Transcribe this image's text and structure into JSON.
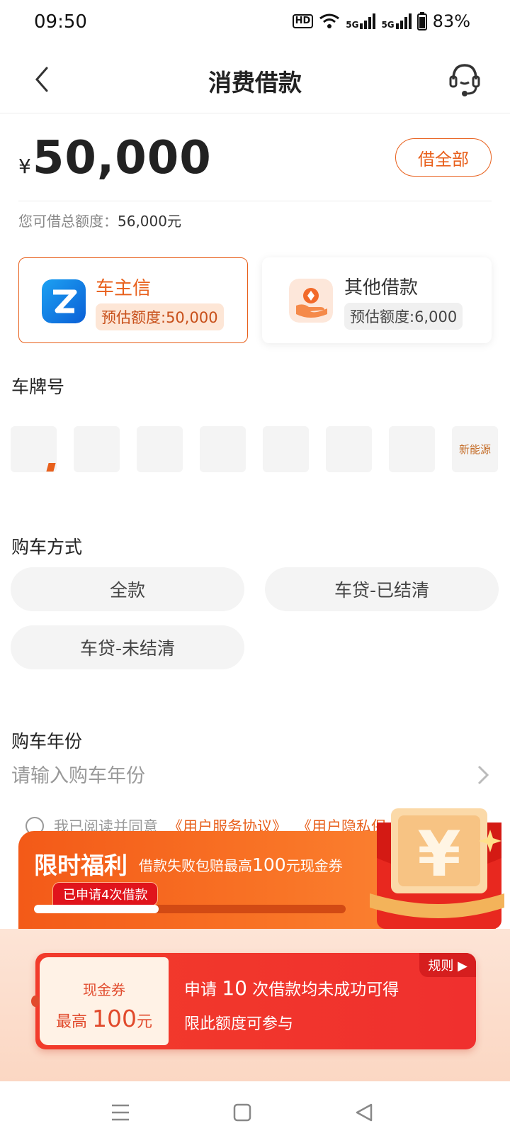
{
  "status": {
    "time": "09:50",
    "hd": "HD",
    "signal1": "5G",
    "signal2": "5G",
    "battery": "83%"
  },
  "nav": {
    "title": "消费借款",
    "back_icon": "back-arrow-icon",
    "service_icon": "customer-service-headset-icon"
  },
  "amount": {
    "currency": "¥",
    "value": "50,000",
    "borrow_all": "借全部",
    "total_label": "您可借总额度：",
    "total_value": "56,000元"
  },
  "loan_cards": [
    {
      "name": "车主信",
      "limit": "预估额度:50,000",
      "icon": "z-logo-icon",
      "selected": true
    },
    {
      "name": "其他借款",
      "limit": "预估额度:6,000",
      "icon": "hand-coin-icon",
      "selected": false
    }
  ],
  "plate": {
    "label": "车牌号",
    "new_energy": "新能源"
  },
  "purchase": {
    "label": "购车方式",
    "options": [
      "全款",
      "车贷-已结清",
      "车贷-未结清"
    ]
  },
  "year": {
    "label": "购车年份",
    "placeholder": "请输入购车年份"
  },
  "agreement": {
    "prefix": "我已阅读并同意",
    "link1": "《用户服务协议》",
    "link2": "《用户隐私保"
  },
  "promo": {
    "title": "限时福利",
    "sub_text": "借款失败包赔最高",
    "sub_amount": "100",
    "sub_suffix": "元现金券",
    "tag": "已申请4次借款",
    "progress": 0.4,
    "accent": "#f35a18"
  },
  "coupon": {
    "left_title": "现金券",
    "left_prefix": "最高",
    "left_amount": "100",
    "left_unit": "元",
    "line1_prefix": "申请",
    "line1_num": "10",
    "line1_suffix": "次借款均未成功可得",
    "line2": "限此额度可参与",
    "rules": "规则 ▶"
  },
  "system_nav": [
    "menu-icon",
    "home-square-icon",
    "back-triangle-icon"
  ]
}
